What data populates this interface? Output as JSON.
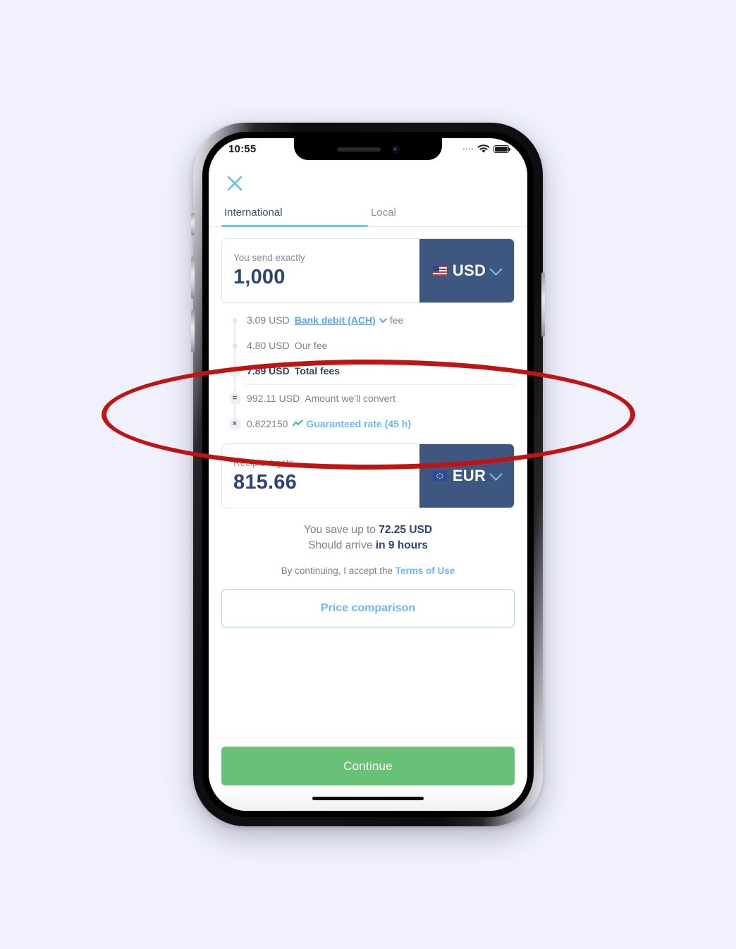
{
  "page": {
    "background_color": "#f0f1fd"
  },
  "status_bar": {
    "time": "10:55",
    "wifi_icon": "wifi-icon",
    "battery_icon": "battery-full-icon"
  },
  "header": {
    "close_icon": "close-icon"
  },
  "tabs": [
    {
      "label": "International",
      "active": true
    },
    {
      "label": "Local",
      "active": false
    }
  ],
  "send_card": {
    "label": "You send exactly",
    "value": "1,000",
    "currency": "USD",
    "flag": "us-flag-icon",
    "chevron": "chevron-down-icon"
  },
  "fees": {
    "rows": [
      {
        "operator": "+",
        "operator_style": "dot",
        "amount": "3.09 USD",
        "link_text": "Bank debit (ACH)",
        "link_chevron": "chevron-down-icon",
        "suffix": "fee"
      },
      {
        "operator": "+",
        "operator_style": "dot",
        "amount": "4.80 USD",
        "description": "Our fee"
      },
      {
        "operator": "−",
        "operator_style": "badge",
        "amount": "7.89 USD",
        "description": "Total fees",
        "emphasis": true
      },
      {
        "operator": "=",
        "operator_style": "badge",
        "amount": "992.11 USD",
        "description": "Amount we'll convert"
      },
      {
        "operator": "×",
        "operator_style": "badge",
        "amount": "0.822150",
        "trend_icon": "trend-line-icon",
        "link_text": "Guaranteed rate (45 h)"
      }
    ]
  },
  "recipient_card": {
    "label": "Recipient gets",
    "value": "815.66",
    "currency": "EUR",
    "flag": "eu-flag-icon",
    "chevron": "chevron-down-icon"
  },
  "summary": {
    "save_prefix": "You save up to ",
    "save_amount": "72.25 USD",
    "arrive_prefix": "Should arrive ",
    "arrive_value": "in 9 hours",
    "terms_prefix": "By continuing, I accept the ",
    "terms_link": "Terms of Use"
  },
  "buttons": {
    "price_comparison": "Price comparison",
    "continue": "Continue"
  },
  "annotation": {
    "shape": "ellipse",
    "color": "#bf1414",
    "highlights": "fee-breakdown-rows"
  },
  "colors": {
    "accent_blue": "#6fb8ef",
    "link_blue": "#5aa9e6",
    "navy": "#2c4374",
    "currency_chip": "#3e5780",
    "continue_green": "#69c178",
    "annotation_red": "#bf1414"
  }
}
